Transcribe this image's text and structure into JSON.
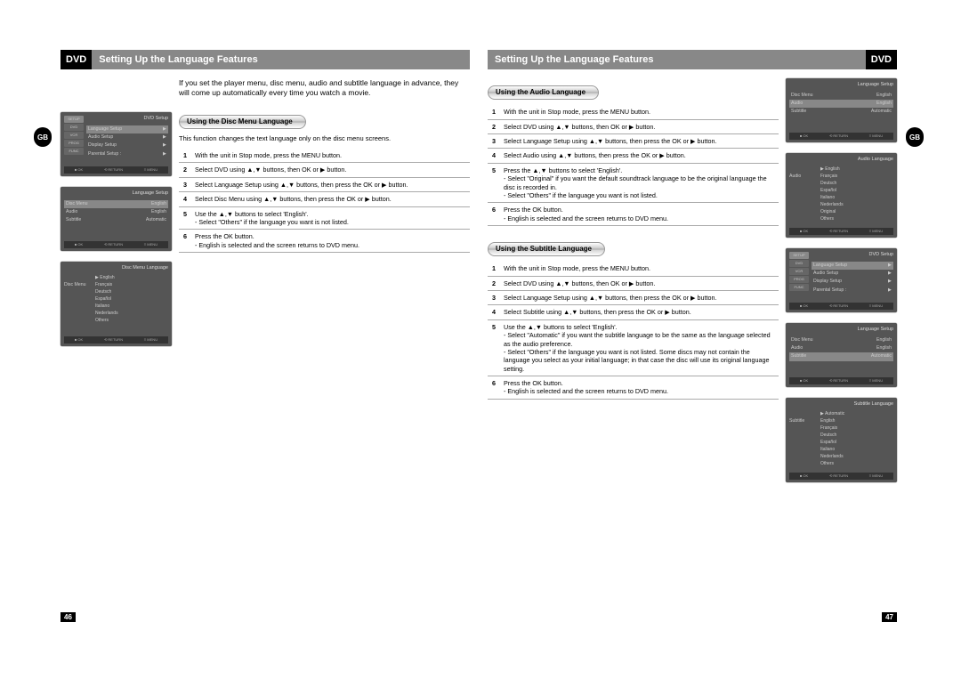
{
  "header": {
    "dvd": "DVD",
    "title": "Setting Up the Language Features",
    "gb": "GB"
  },
  "intro": "If you set the player menu, disc menu, audio and subtitle language in advance, they will come up automatically every time you watch a movie.",
  "disc_menu": {
    "header": "Using the Disc Menu Language",
    "desc": "This function changes the text language only on the disc menu screens.",
    "steps": [
      {
        "n": "1",
        "t": "With the unit in Stop mode, press the MENU button."
      },
      {
        "n": "2",
        "t": "Select DVD using ▲,▼ buttons, then OK or ▶ button."
      },
      {
        "n": "3",
        "t": "Select Language Setup using ▲,▼ buttons, then press the OK or ▶ button."
      },
      {
        "n": "4",
        "t": "Select Disc Menu using ▲,▼ buttons, then press the OK or ▶ button."
      },
      {
        "n": "5",
        "t": "Use the ▲,▼ buttons to select 'English'.",
        "sub": "- Select \"Others\" if the language you want is not listed."
      },
      {
        "n": "6",
        "t": "Press the OK button.",
        "sub": "- English is selected and the screen returns to DVD menu."
      }
    ]
  },
  "audio": {
    "header": "Using the Audio Language",
    "steps": [
      {
        "n": "1",
        "t": "With the unit in Stop mode, press the MENU button."
      },
      {
        "n": "2",
        "t": "Select DVD using ▲,▼ buttons, then OK or ▶ button."
      },
      {
        "n": "3",
        "t": "Select Language Setup using ▲,▼ buttons, then press the OK or ▶ button."
      },
      {
        "n": "4",
        "t": "Select Audio using ▲,▼ buttons, then press the OK or ▶ button."
      },
      {
        "n": "5",
        "t": "Press the ▲,▼ buttons to select 'English'.",
        "sub": "- Select \"Original\" if you want the default soundtrack language to be the original language the disc is recorded in.\n- Select \"Others\" if the language you want is not listed."
      },
      {
        "n": "6",
        "t": "Press the OK button.",
        "sub": "- English is selected and the screen returns to DVD menu."
      }
    ]
  },
  "subtitle": {
    "header": "Using the Subtitle Language",
    "steps": [
      {
        "n": "1",
        "t": "With the unit in Stop mode, press the MENU button."
      },
      {
        "n": "2",
        "t": "Select DVD using ▲,▼ buttons, then OK or ▶ button."
      },
      {
        "n": "3",
        "t": "Select Language Setup using ▲,▼ buttons, then press the OK or ▶ button."
      },
      {
        "n": "4",
        "t": "Select Subtitle using ▲,▼ buttons, then press the OK or ▶ button."
      },
      {
        "n": "5",
        "t": "Use the ▲,▼ buttons to select 'English'.",
        "sub": "- Select \"Automatic\" if you want the subtitle language to be the same as the language selected as the audio preference.\n- Select \"Others\" if the language you want is not listed. Some discs may not contain the language you select as your initial language; in that case the disc will use its original language setting."
      },
      {
        "n": "6",
        "t": "Press the OK button.",
        "sub": "- English is selected and the screen returns to DVD menu."
      }
    ]
  },
  "screens": {
    "dvd_setup": {
      "title": "DVD Setup",
      "tabs": [
        "SETUP",
        "DVD",
        "VCR",
        "PROG",
        "FUNC"
      ],
      "items": [
        {
          "label": "Language Setup",
          "value": "▶",
          "hl": true
        },
        {
          "label": "Audio Setup",
          "value": "▶"
        },
        {
          "label": "Display Setup",
          "value": "▶"
        },
        {
          "label": "Parental Setup :",
          "value": "▶"
        }
      ]
    },
    "lang_setup": {
      "title": "Language Setup",
      "items": [
        {
          "label": "Disc Menu",
          "value": "English",
          "hl": true
        },
        {
          "label": "Audio",
          "value": "English"
        },
        {
          "label": "Subtitle",
          "value": "Automatic"
        }
      ]
    },
    "lang_setup_audio": {
      "title": "Language Setup",
      "items": [
        {
          "label": "Disc Menu",
          "value": "English"
        },
        {
          "label": "Audio",
          "value": "English",
          "hl": true
        },
        {
          "label": "Subtitle",
          "value": "Automatic"
        }
      ]
    },
    "lang_setup_sub": {
      "title": "Language Setup",
      "items": [
        {
          "label": "Disc Menu",
          "value": "English"
        },
        {
          "label": "Audio",
          "value": "English"
        },
        {
          "label": "Subtitle",
          "value": "Automatic",
          "hl": true
        }
      ]
    },
    "disc_menu_lang": {
      "title": "Disc Menu Language",
      "left_label": "Disc Menu",
      "langs": [
        "English",
        "Français",
        "Deutsch",
        "Español",
        "Italiano",
        "Nederlands",
        "Others"
      ],
      "selected": "English"
    },
    "audio_lang": {
      "title": "Audio Language",
      "left_label": "Audio",
      "langs": [
        "English",
        "Français",
        "Deutsch",
        "Español",
        "Italiano",
        "Nederlands",
        "Original",
        "Others"
      ],
      "selected": "English"
    },
    "subtitle_lang": {
      "title": "Subtitle Language",
      "left_label": "Subtitle",
      "langs": [
        "Automatic",
        "English",
        "Français",
        "Deutsch",
        "Español",
        "Italiano",
        "Nederlands",
        "Others"
      ],
      "selected": "Automatic"
    },
    "bottombar": [
      "■ OK",
      "⟲ RETURN",
      "≡ MENU"
    ]
  },
  "page_numbers": {
    "left": "46",
    "right": "47"
  }
}
